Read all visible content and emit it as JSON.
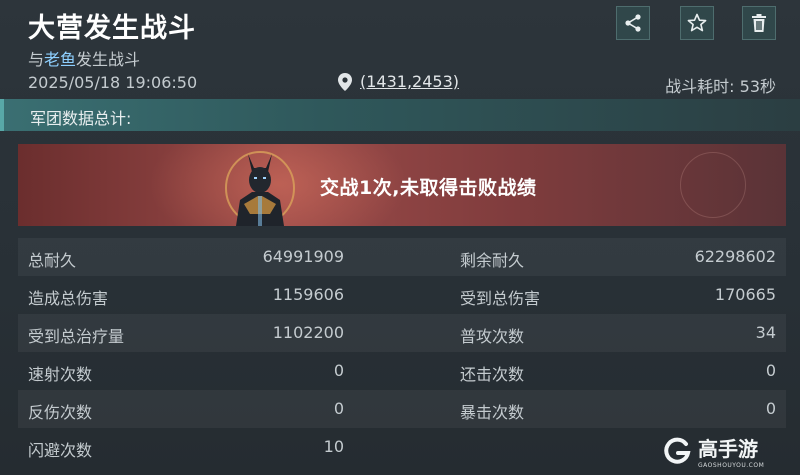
{
  "header": {
    "title": "大营发生战斗",
    "subtitle_prefix": "与",
    "subtitle_name": "老鱼",
    "subtitle_suffix": "发生战斗",
    "datetime": "2025/05/18  19:06:50",
    "coordinates": "(1431,2453)",
    "duration": "战斗耗时: 53秒"
  },
  "toolbar": {
    "share_icon": "share-icon",
    "star_icon": "star-icon",
    "trash_icon": "trash-icon",
    "accent_color": "#30474a"
  },
  "section": {
    "title": "军团数据总计:"
  },
  "banner": {
    "text": "交战1次,未取得击败战绩"
  },
  "stats": [
    {
      "l1": "总耐久",
      "v1": "64991909",
      "l2": "剩余耐久",
      "v2": "62298602"
    },
    {
      "l1": "造成总伤害",
      "v1": "1159606",
      "l2": "受到总伤害",
      "v2": "170665"
    },
    {
      "l1": "受到总治疗量",
      "v1": "1102200",
      "l2": "普攻次数",
      "v2": "34"
    },
    {
      "l1": "速射次数",
      "v1": "0",
      "l2": "还击次数",
      "v2": "0"
    },
    {
      "l1": "反伤次数",
      "v1": "0",
      "l2": "暴击次数",
      "v2": "0"
    },
    {
      "l1": "闪避次数",
      "v1": "10",
      "l2": "",
      "v2": ""
    }
  ],
  "watermark": {
    "main": "高手游",
    "sub": "GAOSHOUYOU.COM"
  }
}
